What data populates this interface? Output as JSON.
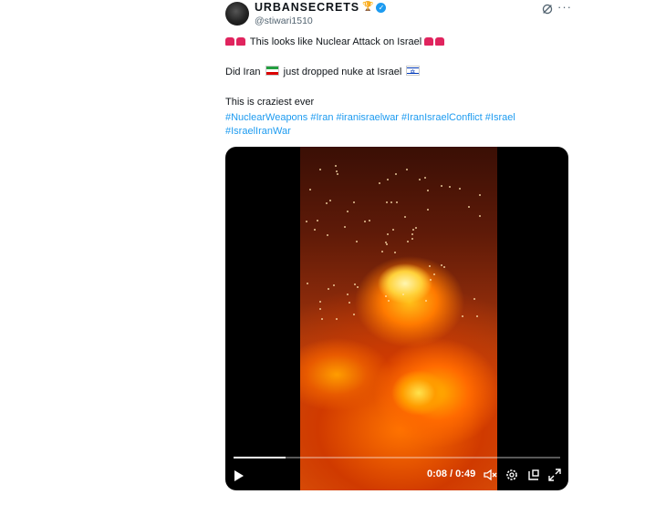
{
  "author": {
    "display_name": "URBANSECRETS",
    "handle": "@stiwari1510",
    "badge_icon": "trophy-emoji",
    "verified_icon": "verified-check-icon"
  },
  "header_actions": [
    "grok-icon",
    "more-options-icon"
  ],
  "tweet": {
    "line1_text": "This looks like Nuclear Attack on Israel",
    "line2_before_flag": "Did Iran",
    "line2_after_flag": "just dropped nuke at Israel",
    "line3_text": "This is craziest ever",
    "hashtags": [
      "#NuclearWeapons",
      "#Iran",
      "#iranisraelwar",
      "#IranIsraelConflict",
      "#Israel",
      "#IsraelIranWar"
    ]
  },
  "video": {
    "time_display": "0:08 / 0:49",
    "progress": 0.16,
    "controls": [
      "play-icon",
      "volume-muted-icon",
      "settings-icon",
      "pop-out-icon",
      "fullscreen-icon"
    ]
  },
  "colors": {
    "link": "#1d9bf0",
    "siren": "#e0245e",
    "verified": "#1d9bf0"
  }
}
